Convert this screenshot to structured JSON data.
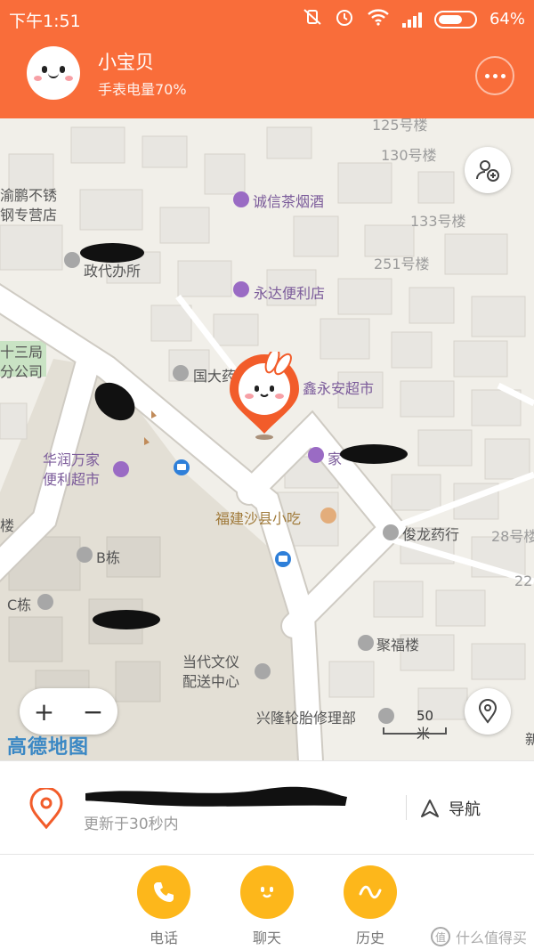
{
  "status_bar": {
    "time": "下午1:51",
    "battery": "64%"
  },
  "header": {
    "child_name": "小宝贝",
    "watch_battery": "手表电量70%"
  },
  "map": {
    "labels": {
      "yupeng": "渝鹏不锈\n钢专营店",
      "chengxin": "诚信茶烟酒",
      "yongda": "永达便利店",
      "zhengdai": "政代办所",
      "no130": "130号楼",
      "no133": "133号楼",
      "no251": "251号楼",
      "no125": "125号楼",
      "shisanju": "十三局\n分公司",
      "guoda": "国大药房",
      "xinyongan": "鑫永安超市",
      "huarun": "华润万家\n便利超市",
      "jia": "家",
      "shaxian": "福建沙县小吃",
      "junlong": "俊龙药行",
      "no28": "28号楼",
      "no22": "22",
      "lou": "楼",
      "bdong": "B栋",
      "cdong": "C栋",
      "jufu": "聚福楼",
      "dangdai": "当代文仪\n配送中心",
      "xinglong": "兴隆轮胎修理部",
      "xin": "新"
    },
    "scale": "50米",
    "logo": "高德地图",
    "zoom_in": "+",
    "zoom_out": "−"
  },
  "location": {
    "updated": "更新于30秒内",
    "nav_label": "导航"
  },
  "actions": [
    {
      "label": "电话",
      "icon": "phone-icon"
    },
    {
      "label": "聊天",
      "icon": "chat-face-icon"
    },
    {
      "label": "历史",
      "icon": "history-path-icon"
    }
  ],
  "watermark": "什么值得买",
  "colors": {
    "header": "#f96d3a",
    "action": "#fdb71b",
    "poi": "#9a6bc4",
    "road": "#ffffff",
    "map_bg": "#f1efe9"
  }
}
